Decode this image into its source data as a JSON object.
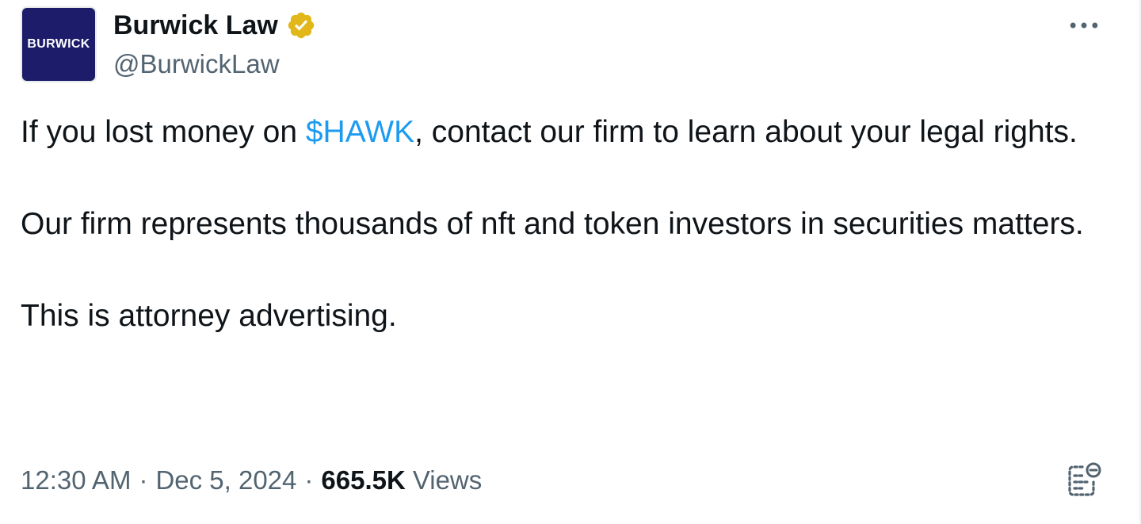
{
  "account": {
    "avatar_text": "BURWICK",
    "display_name": "Burwick Law",
    "handle": "@BurwickLaw",
    "verified_badge_icon": "gold-verified-badge-icon",
    "avatar_bg": "#1c1c6b",
    "badge_color": "#e2b719"
  },
  "tweet": {
    "para1_before": "If you lost money on ",
    "cashtag": "$HAWK",
    "para1_after": ", contact our firm to learn about your legal rights.",
    "para2": "Our firm represents thousands of nft and token investors in securities matters.",
    "para3": "This is attorney advertising.",
    "link_color": "#1d9bf0"
  },
  "meta": {
    "time": "12:30 AM",
    "separator": "·",
    "date": "Dec 5, 2024",
    "views_count": "665.5K",
    "views_label": "Views"
  },
  "icons": {
    "more": "more-horizontal-icon",
    "analytics": "analytics-icon"
  }
}
